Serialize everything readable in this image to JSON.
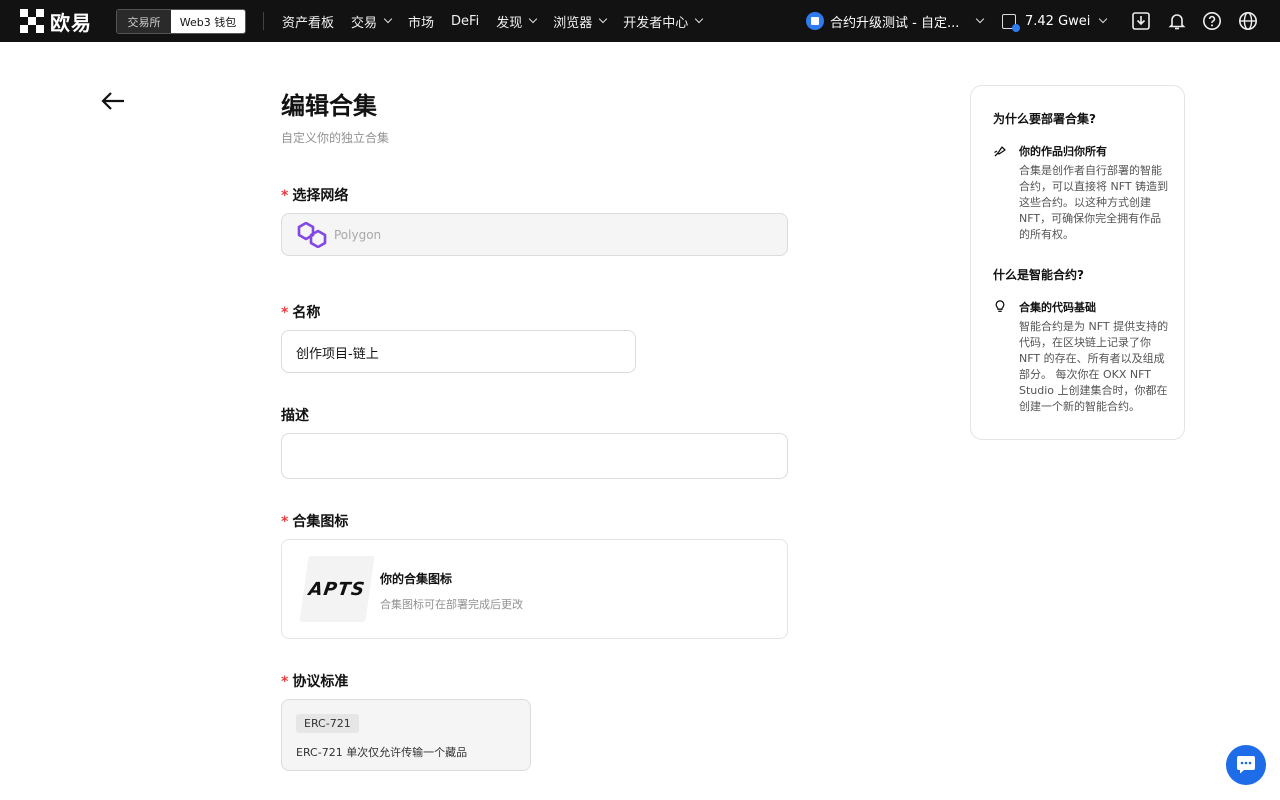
{
  "brand": {
    "name": "欧易"
  },
  "mode_switch": {
    "exchange": "交易所",
    "wallet": "Web3 钱包"
  },
  "nav": [
    {
      "label": "资产看板",
      "dropdown": false
    },
    {
      "label": "交易",
      "dropdown": true
    },
    {
      "label": "市场",
      "dropdown": false
    },
    {
      "label": "DeFi",
      "dropdown": false
    },
    {
      "label": "发现",
      "dropdown": true
    },
    {
      "label": "浏览器",
      "dropdown": true
    },
    {
      "label": "开发者中心",
      "dropdown": true
    }
  ],
  "project": {
    "label": "合约升级测试 - 自定..."
  },
  "gas": {
    "label": "7.42 Gwei"
  },
  "page": {
    "title": "编辑合集",
    "subtitle": "自定义你的独立合集"
  },
  "network": {
    "label": "选择网络",
    "value": "Polygon"
  },
  "name": {
    "label": "名称",
    "value": "创作项目-链上"
  },
  "description": {
    "label": "描述",
    "value": ""
  },
  "collection_icon": {
    "label": "合集图标",
    "image_text": "APTS",
    "title": "你的合集图标",
    "hint": "合集图标可在部署完成后更改"
  },
  "protocol": {
    "label": "协议标准",
    "tag": "ERC-721",
    "description": "ERC-721 单次仅允许传输一个藏品"
  },
  "side": {
    "why_title": "为什么要部署合集?",
    "why_sub": "你的作品归你所有",
    "why_body": "合集是创作者自行部署的智能合约，可以直接将 NFT 铸造到这些合约。以这种方式创建 NFT，可确保你完全拥有作品的所有权。",
    "what_title": "什么是智能合约?",
    "what_sub": "合集的代码基础",
    "what_body": "智能合约是为 NFT 提供支持的代码，在区块链上记录了你 NFT 的存在、所有者以及组成部分。 每次你在 OKX NFT Studio 上创建集合时，你都在创建一个新的智能合约。"
  },
  "colors": {
    "accent": "#1f6ce8",
    "required": "#ea3c3c",
    "polygon": "#8247e5"
  }
}
